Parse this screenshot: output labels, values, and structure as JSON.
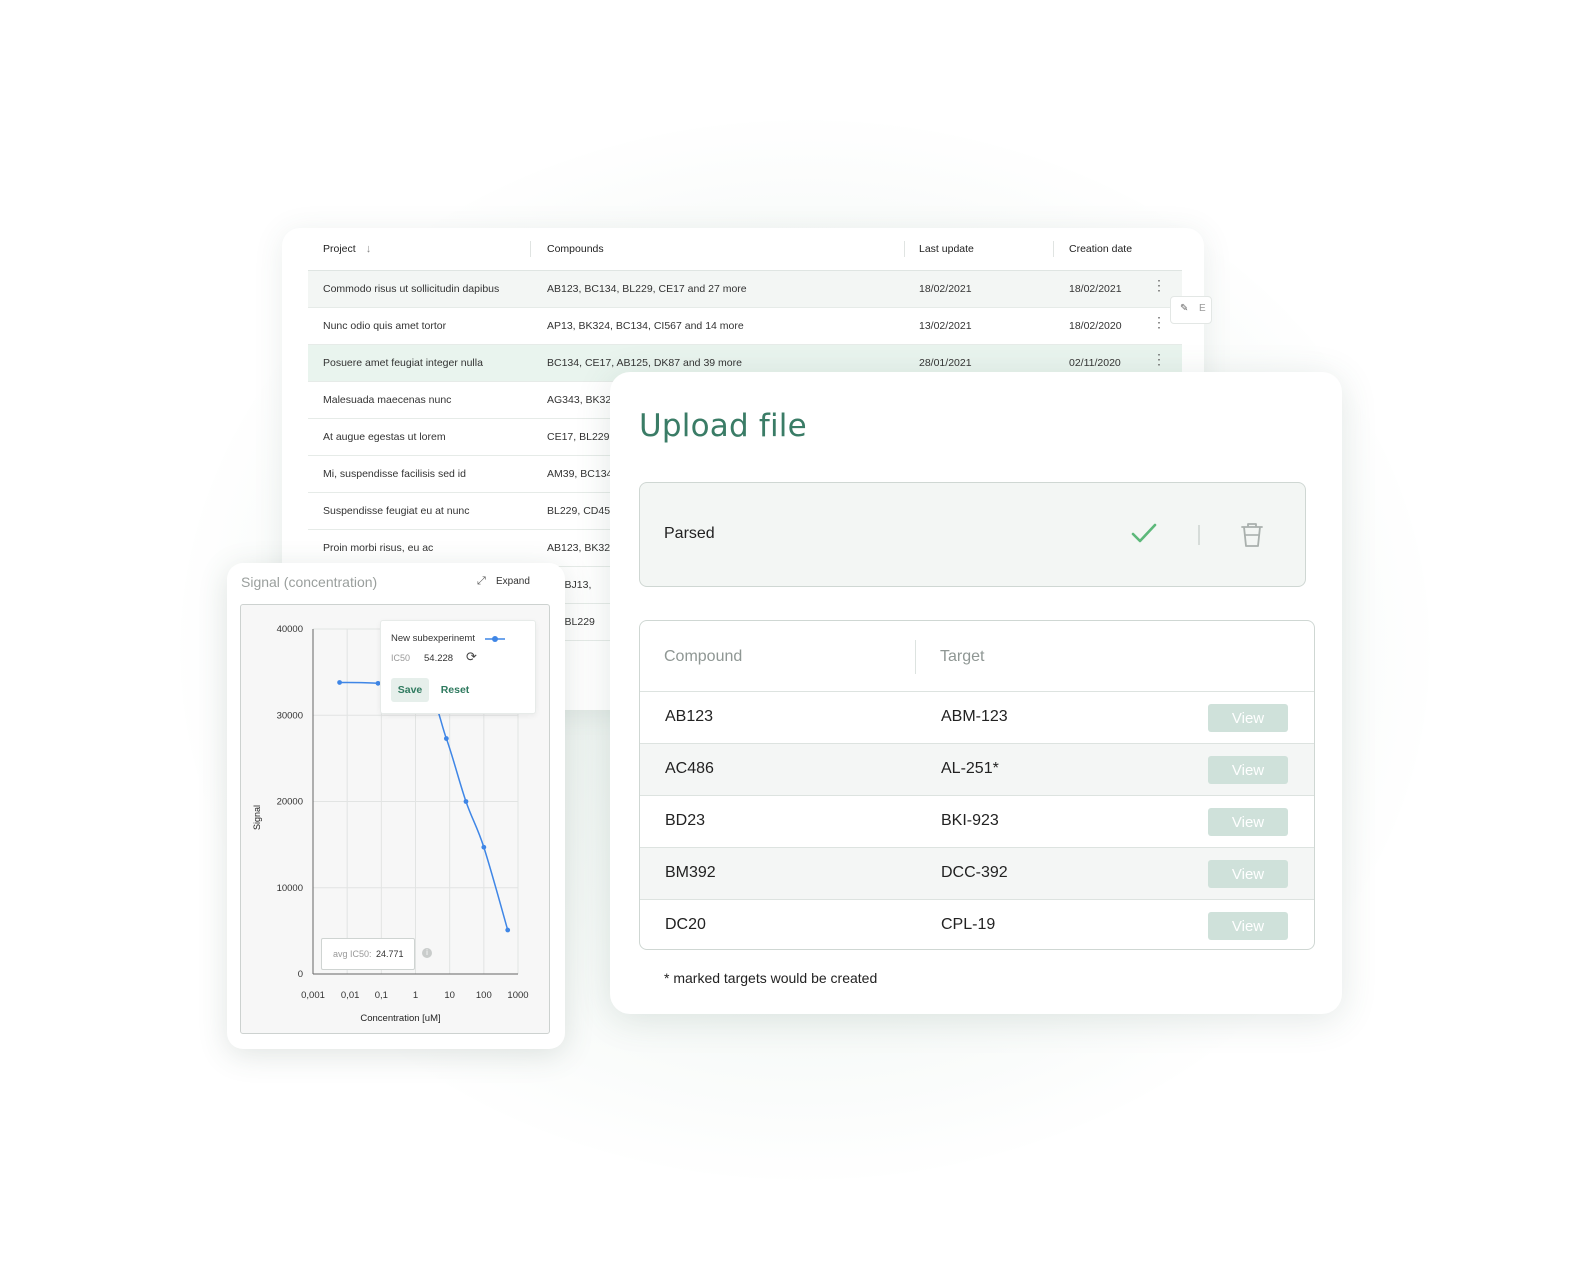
{
  "projects": {
    "headers": {
      "project": "Project",
      "compounds": "Compounds",
      "last_update": "Last update",
      "creation_date": "Creation date"
    },
    "rows": [
      {
        "project": "Commodo risus ut sollicitudin dapibus",
        "compounds": "AB123, BC134, BL229, CE17 and 27 more",
        "last_update": "18/02/2021",
        "creation_date": "18/02/2021"
      },
      {
        "project": "Nunc odio quis amet tortor",
        "compounds": "AP13, BK324, BC134, CI567 and 14 more",
        "last_update": "13/02/2021",
        "creation_date": "18/02/2020"
      },
      {
        "project": "Posuere amet feugiat integer nulla",
        "compounds": "BC134, CE17, AB125, DK87 and 39 more",
        "last_update": "28/01/2021",
        "creation_date": "02/11/2020"
      },
      {
        "project": "Malesuada maecenas nunc",
        "compounds": "AG343, BK324",
        "last_update": "",
        "creation_date": ""
      },
      {
        "project": "At augue egestas ut lorem",
        "compounds": "CE17, BL229, A",
        "last_update": "",
        "creation_date": ""
      },
      {
        "project": "Mi, suspendisse facilisis sed id",
        "compounds": "AM39, BC134,",
        "last_update": "",
        "creation_date": ""
      },
      {
        "project": "Suspendisse feugiat eu at nunc",
        "compounds": "BL229, CD45,",
        "last_update": "",
        "creation_date": ""
      },
      {
        "project": "Proin morbi risus, eu ac",
        "compounds": "AB123, BK324",
        "last_update": "",
        "creation_date": ""
      },
      {
        "project": "",
        "compounds": "94, BJ13,",
        "last_update": "",
        "creation_date": ""
      },
      {
        "project": "",
        "compounds": "24, BL229",
        "last_update": "",
        "creation_date": ""
      }
    ],
    "edit_label": "E"
  },
  "upload": {
    "title": "Upload file",
    "status": "Parsed",
    "table": {
      "headers": {
        "compound": "Compound",
        "target": "Target"
      },
      "view_label": "View",
      "rows": [
        {
          "compound": "AB123",
          "target": "ABM-123"
        },
        {
          "compound": "AC486",
          "target": "AL-251*"
        },
        {
          "compound": "BD23",
          "target": "BKI-923"
        },
        {
          "compound": "BM392",
          "target": "DCC-392"
        },
        {
          "compound": "DC20",
          "target": "CPL-19"
        }
      ]
    },
    "note": "* marked targets would be created",
    "colors": {
      "accent": "#3a7c66",
      "check": "#5cb87a",
      "view_button": "#cfe1da"
    }
  },
  "chart_panel": {
    "title": "Signal (concentration)",
    "expand_label": "Expand",
    "legend": {
      "series_name": "New subexperinemt",
      "ic50_label": "IC50",
      "ic50_value": "54.228",
      "save_label": "Save",
      "reset_label": "Reset"
    },
    "avg": {
      "label": "avg IC50:",
      "value": "24.771"
    }
  },
  "chart_data": {
    "type": "line",
    "title": "Signal (concentration)",
    "xlabel": "Concentration [uM]",
    "ylabel": "Signal",
    "x_scale": "log",
    "x_ticks": [
      "0,001",
      "0,01",
      "0,1",
      "1",
      "10",
      "100",
      "1000"
    ],
    "x_tick_values": [
      0.001,
      0.01,
      0.1,
      1,
      10,
      100,
      1000
    ],
    "y_ticks": [
      "0",
      "10000",
      "20000",
      "30000",
      "40000"
    ],
    "y_tick_values": [
      0,
      10000,
      20000,
      30000,
      40000
    ],
    "xlim": [
      0.001,
      1000
    ],
    "ylim": [
      0,
      40000
    ],
    "grid": true,
    "color": "#3f86e6",
    "series": [
      {
        "name": "New subexperinemt",
        "x": [
          0.006,
          0.08,
          2,
          8,
          30,
          100,
          500
        ],
        "y": [
          33800,
          33700,
          33000,
          27300,
          20000,
          14700,
          5100
        ]
      }
    ]
  }
}
